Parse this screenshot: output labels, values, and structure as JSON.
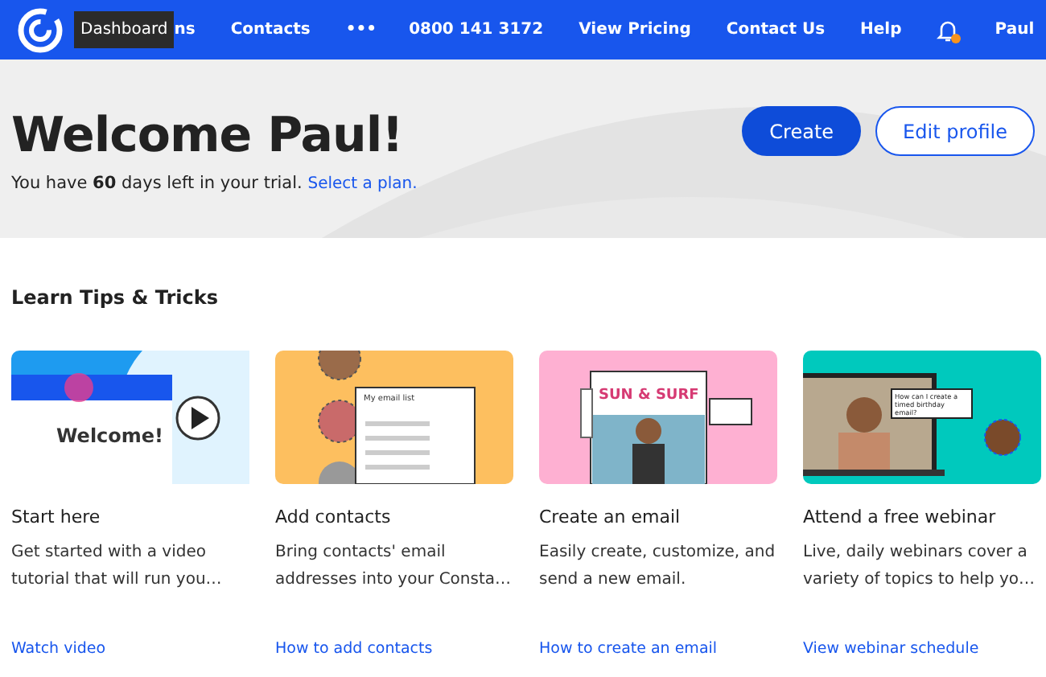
{
  "header": {
    "tooltip": "Dashboard",
    "nav": [
      {
        "label": "ns"
      },
      {
        "label": "Contacts"
      },
      {
        "label": "•••"
      }
    ],
    "right_links": [
      {
        "label": "0800 141 3172"
      },
      {
        "label": "View Pricing"
      },
      {
        "label": "Contact Us"
      },
      {
        "label": "Help"
      }
    ],
    "notifications": {
      "has_unread": true
    },
    "user": {
      "name": "Paul"
    }
  },
  "hero": {
    "title": "Welcome Paul!",
    "trial_text": "You have **60** days left in your trial.",
    "trial_link": "Select a plan.",
    "buttons": [
      {
        "label": "Create",
        "kind": "primary"
      },
      {
        "label": "Edit profile",
        "kind": "outline"
      }
    ]
  },
  "tips": {
    "heading": "Learn Tips & Tricks",
    "cards": [
      {
        "kind": "video",
        "image_text": "Welcome!",
        "title": "Start here",
        "description": "Get started with a video tutorial that will run you…",
        "link": "Watch video"
      },
      {
        "kind": "contacts",
        "image_text": "My email list",
        "title": "Add contacts",
        "description": "Bring contacts' email addresses into your Consta…",
        "link": "How to add contacts"
      },
      {
        "kind": "email",
        "image_text": "SUN & SURF",
        "title": "Create an email",
        "description": "Easily create, customize, and send a new email.",
        "link": "How to create an email"
      },
      {
        "kind": "webinar",
        "image_text": "How can I create a timed birthday email?",
        "title": "Attend a free webinar",
        "description": "Live, daily webinars cover a variety of topics to help yo…",
        "link": "View webinar schedule"
      }
    ]
  }
}
